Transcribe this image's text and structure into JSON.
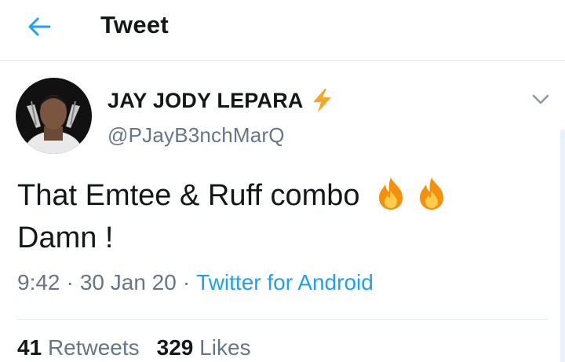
{
  "header": {
    "title": "Tweet",
    "back_icon": "arrow-left-icon"
  },
  "tweet": {
    "author": {
      "display_name": "JAY JODY LEPARA",
      "badge_icon": "lightning-bolt-icon",
      "handle": "@PJayB3nchMarQ"
    },
    "text_line1": "That Emtee & Ruff combo",
    "emojis": [
      "fire-emoji",
      "fire-emoji"
    ],
    "text_line2": "Damn !",
    "time": "9:42",
    "date": "30 Jan 20",
    "separator": "·",
    "source": "Twitter for Android",
    "retweets_count": "41",
    "retweets_label": "Retweets",
    "likes_count": "329",
    "likes_label": "Likes"
  },
  "colors": {
    "accent": "#1da1f2",
    "secondary_text": "#657786",
    "primary_text": "#14171a",
    "bolt": "#f5a623"
  }
}
